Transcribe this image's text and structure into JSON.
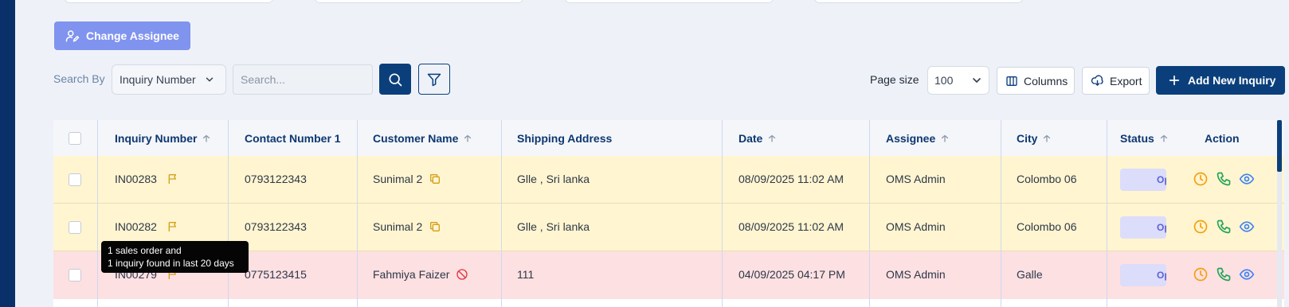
{
  "toolbar": {
    "change_assignee_label": "Change Assignee",
    "search_by_label": "Search By",
    "search_by_value": "Inquiry Number",
    "search_placeholder": "Search...",
    "page_size_label": "Page size",
    "page_size_value": "100",
    "columns_label": "Columns",
    "export_label": "Export",
    "add_label": "Add New Inquiry"
  },
  "table": {
    "headers": [
      "Inquiry Number",
      "Contact Number 1",
      "Customer Name",
      "Shipping Address",
      "Date",
      "Assignee",
      "City",
      "Status",
      "Action"
    ],
    "rows": [
      {
        "inquiry": "IN00283",
        "contact": "0793122343",
        "customer": "Sunimal 2",
        "address": "Glle , Sri lanka",
        "date": "08/09/2025 11:02 AM",
        "assignee": "OMS Admin",
        "city": "Colombo 06",
        "status": "Op"
      },
      {
        "inquiry": "IN00282",
        "contact": "0793122343",
        "customer": "Sunimal 2",
        "address": "Glle , Sri lanka",
        "date": "08/09/2025 11:02 AM",
        "assignee": "OMS Admin",
        "city": "Colombo 06",
        "status": "Op"
      },
      {
        "inquiry": "IN00279",
        "contact": "0775123415",
        "customer": "Fahmiya Faizer",
        "address": "111",
        "date": "04/09/2025 04:17 PM",
        "assignee": "OMS Admin",
        "city": "Galle",
        "status": "Op"
      }
    ]
  },
  "tooltip": {
    "line1": "1 sales order and",
    "line2": "1 inquiry found in last 20 days"
  },
  "colors": {
    "primary": "#0b3f7c",
    "accent_button": "#8093ef",
    "row_warning": "#fff5d0",
    "row_error": "#fde0e2",
    "flag": "#d4a017",
    "history_icon": "#f59e0b",
    "phone_icon": "#22a35a",
    "view_icon": "#3b82f6"
  }
}
